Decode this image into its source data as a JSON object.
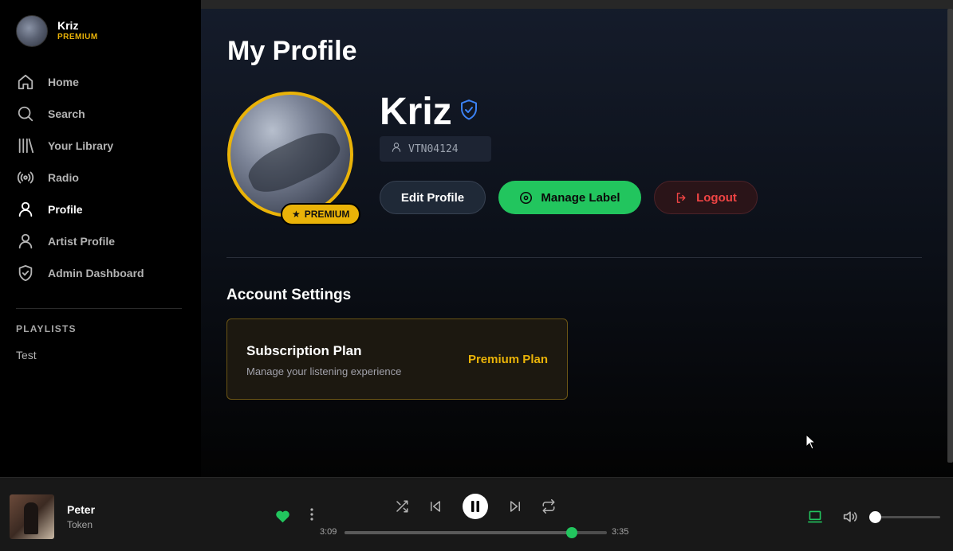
{
  "sidebar": {
    "user": {
      "name": "Kriz",
      "tier": "PREMIUM"
    },
    "nav": [
      {
        "label": "Home",
        "icon": "home-icon"
      },
      {
        "label": "Search",
        "icon": "search-icon"
      },
      {
        "label": "Your Library",
        "icon": "library-icon"
      },
      {
        "label": "Radio",
        "icon": "radio-icon"
      },
      {
        "label": "Profile",
        "icon": "user-icon",
        "active": true
      },
      {
        "label": "Artist Profile",
        "icon": "user-icon"
      },
      {
        "label": "Admin Dashboard",
        "icon": "shield-icon"
      }
    ],
    "playlists_heading": "PLAYLISTS",
    "playlists": [
      "Test"
    ]
  },
  "main": {
    "page_title": "My Profile",
    "profile": {
      "name": "Kriz",
      "user_id": "VTN04124",
      "badge": "PREMIUM",
      "verified_icon": "shield-check-icon"
    },
    "buttons": {
      "edit": "Edit Profile",
      "manage_label": "Manage Label",
      "logout": "Logout"
    },
    "account_settings": {
      "title": "Account Settings",
      "subscription": {
        "title": "Subscription Plan",
        "subtitle": "Manage your listening experience",
        "value": "Premium Plan"
      }
    }
  },
  "player": {
    "track": {
      "title": "Peter",
      "artist": "Token"
    },
    "liked": true,
    "time_current": "3:09",
    "time_total": "3:35",
    "progress": 0.865,
    "volume": 0.08
  },
  "colors": {
    "accent_green": "#22c55e",
    "premium_gold": "#eab308",
    "logout_red": "#ef4444"
  }
}
